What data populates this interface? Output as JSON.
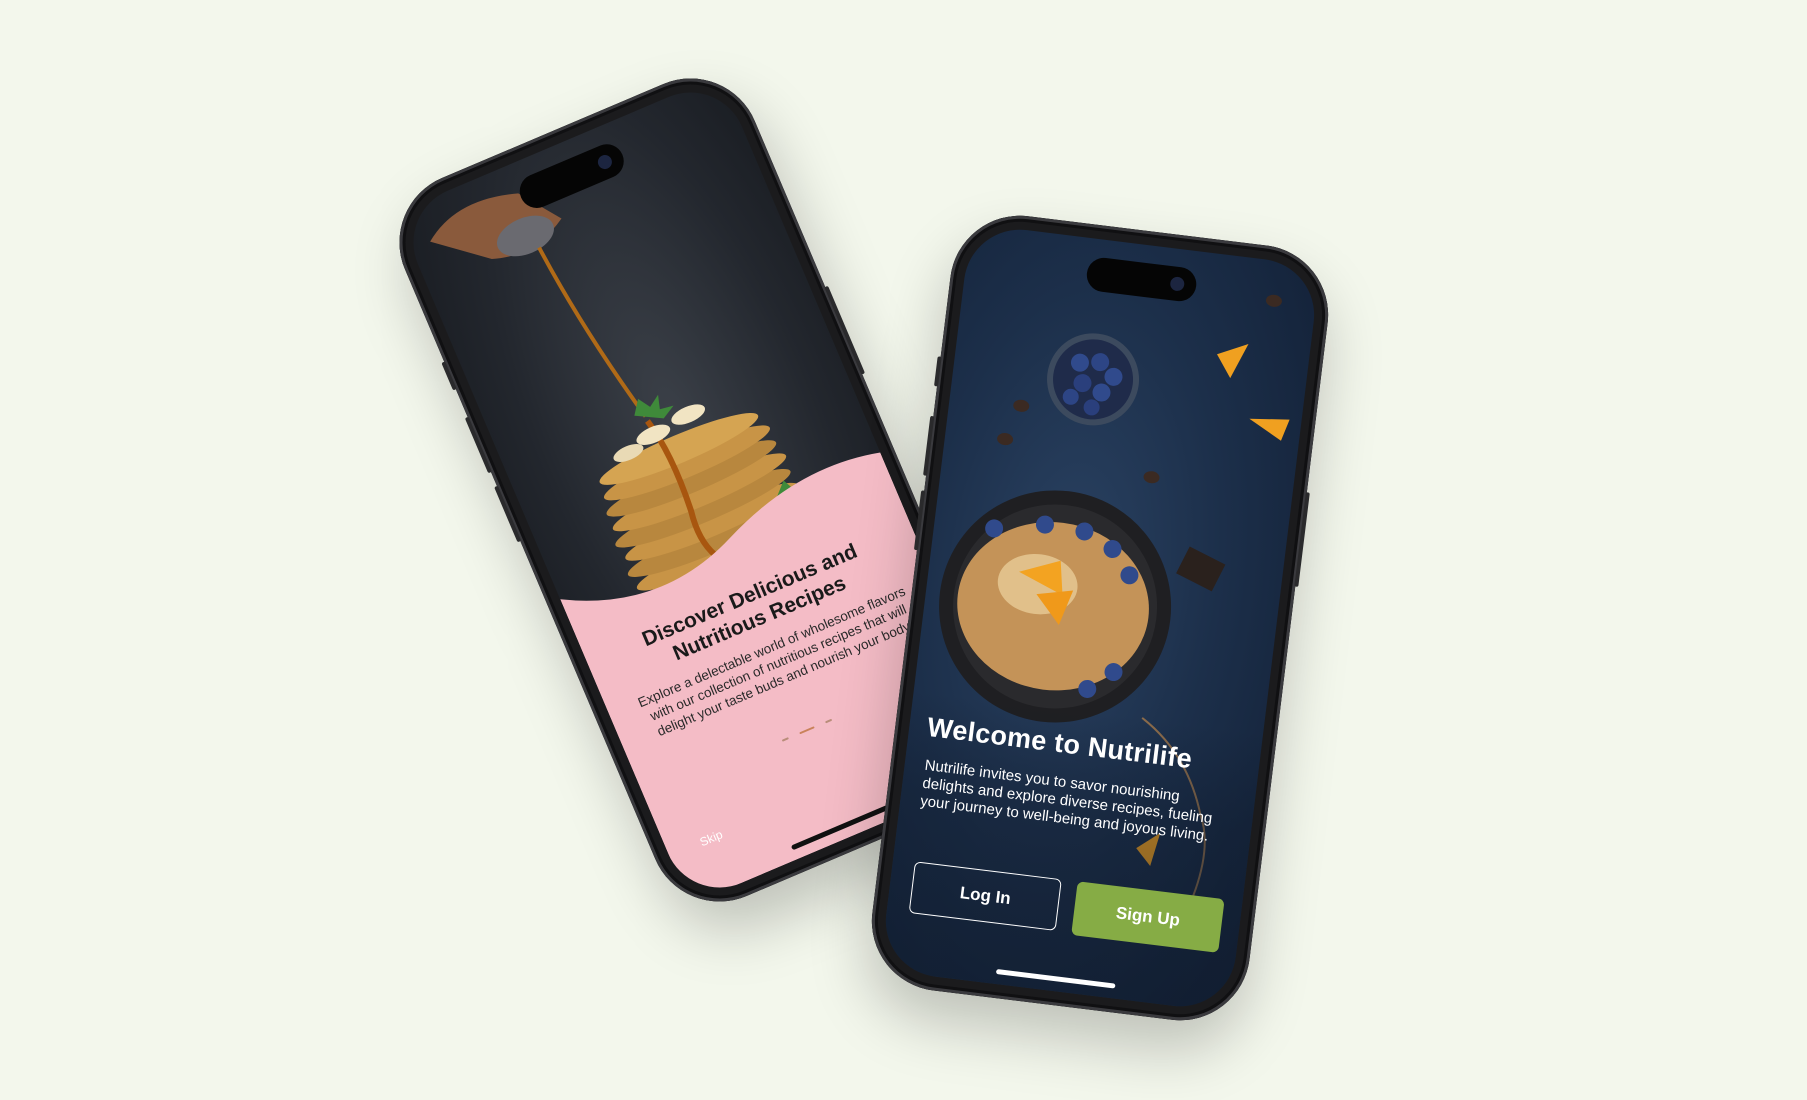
{
  "onboarding": {
    "title": "Discover Delicious and Nutritious Recipes",
    "body": "Explore a delectable world of wholesome flavors with our collection of nutritious recipes that will delight your taste buds and nourish your body.",
    "skip_label": "Skip",
    "page_indicator": {
      "count": 3,
      "active": 1
    }
  },
  "welcome": {
    "title": "Welcome to Nutrilife",
    "body": "Nutrilife invites you to savor nourishing delights and explore diverse recipes, fueling your journey to well-being and joyous living.",
    "login_label": "Log In",
    "signup_label": "Sign Up"
  },
  "colors": {
    "page_background": "#f3f7ec",
    "onboarding_panel": "#f4bcc6",
    "accent_green": "#86ac45",
    "phone_frame": "#1b1b1d"
  },
  "icons": [
    "pancake-stack-photo",
    "blueberry-bowl-photo",
    "orange-slice-photo"
  ]
}
